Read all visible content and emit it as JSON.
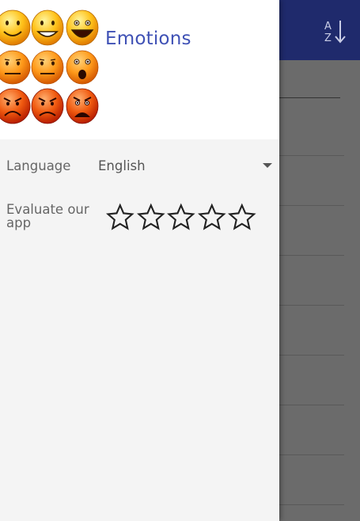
{
  "app": {
    "title": "Emotions"
  },
  "background": {
    "toolbar_icon": "sort-alphabetical-icon",
    "toolbar_color": "#1f2a6c",
    "sort_icon_letters": {
      "top": "A",
      "bottom": "Z"
    }
  },
  "drawer": {
    "language": {
      "label": "Language",
      "value": "English"
    },
    "rate": {
      "label": "Evaluate our app",
      "star_count": 5,
      "rating": 0
    }
  },
  "colors": {
    "accent": "#3f51b5",
    "scrim": "#6b6b6b"
  },
  "emoji_grid": {
    "rows": 3,
    "cols": 3,
    "expressions": [
      "smile",
      "grin",
      "big-grin",
      "neutral",
      "neutral",
      "surprised",
      "angry",
      "frown",
      "angry-shout"
    ]
  }
}
